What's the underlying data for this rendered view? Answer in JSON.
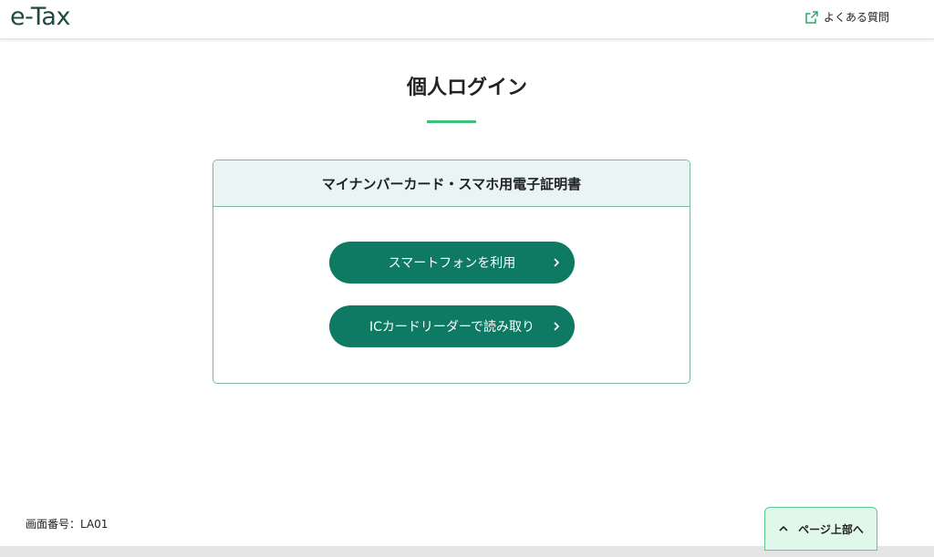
{
  "header": {
    "logo": "e-Tax",
    "faq_label": "よくある質問",
    "faq_icon": "external-link-icon"
  },
  "main": {
    "title": "個人ログイン",
    "card": {
      "title": "マイナンバーカード・スマホ用電子証明書",
      "buttons": [
        {
          "label": "スマートフォンを利用",
          "icon": "chevron-right-icon"
        },
        {
          "label": "ICカードリーダーで読み取り",
          "icon": "chevron-right-icon"
        }
      ]
    }
  },
  "footer": {
    "screen_id": "画面番号：LA01",
    "page_top_label": "ページ上部へ",
    "page_top_icon": "chevron-up-icon"
  },
  "colors": {
    "brand": "#1f4a42",
    "accent_green": "#3cc07c",
    "button_green": "#0e7a64",
    "card_header_bg": "#e9f4f4",
    "page_top_bg": "#e0f8ea"
  }
}
